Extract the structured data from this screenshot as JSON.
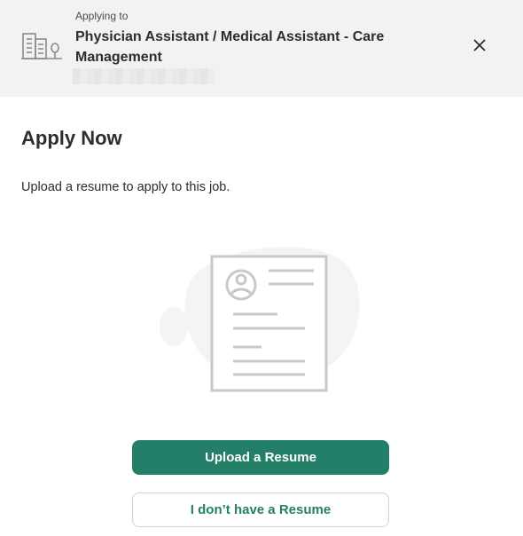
{
  "header": {
    "applying_label": "Applying to",
    "job_title": "Physician Assistant / Medical Assistant - Care Management",
    "company_icon": "building-icon",
    "close_icon": "close-icon"
  },
  "main": {
    "title": "Apply Now",
    "instruction": "Upload a resume to apply to this job.",
    "illustration_icon": "resume-document-icon"
  },
  "actions": {
    "upload_label": "Upload a Resume",
    "no_resume_label": "I don’t have a Resume"
  },
  "colors": {
    "header_bg": "#f2f2f2",
    "primary": "#247f69",
    "text": "#2d2d2d"
  }
}
